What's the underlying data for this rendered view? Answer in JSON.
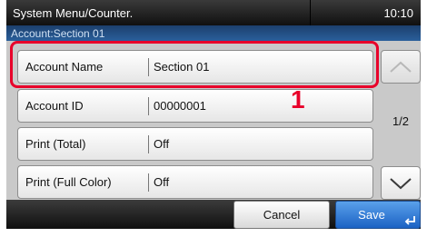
{
  "header": {
    "title": "System Menu/Counter.",
    "clock": "10:10"
  },
  "subheader": {
    "text": "Account:Section 01"
  },
  "rows": [
    {
      "label": "Account Name",
      "value": "Section 01"
    },
    {
      "label": "Account ID",
      "value": "00000001"
    },
    {
      "label": "Print (Total)",
      "value": "Off"
    },
    {
      "label": "Print (Full Color)",
      "value": "Off"
    }
  ],
  "pagination": {
    "indicator": "1/2"
  },
  "annotation": {
    "callout_number": "1"
  },
  "footer": {
    "cancel_label": "Cancel",
    "save_label": "Save"
  },
  "colors": {
    "highlight": "#e8002a",
    "save_button": "#2a74d6",
    "subheader": "#234f85"
  },
  "icons": {
    "scroll_up": "chevron-up-icon",
    "scroll_down": "chevron-down-icon",
    "enter": "enter-arrow-icon"
  }
}
